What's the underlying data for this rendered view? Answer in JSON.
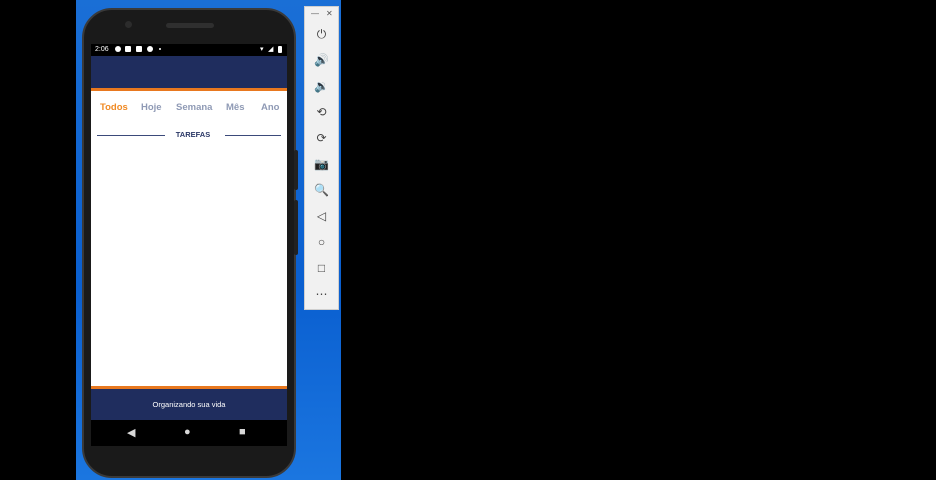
{
  "status_bar": {
    "time": "2:06"
  },
  "tabs": [
    {
      "label": "Todos",
      "active": true
    },
    {
      "label": "Hoje"
    },
    {
      "label": "Semana"
    },
    {
      "label": "Mês"
    },
    {
      "label": "Ano"
    }
  ],
  "section": {
    "title": "TAREFAS"
  },
  "footer": {
    "text": "Organizando sua vida"
  },
  "colors": {
    "brand": "#1f2d5e",
    "accent": "#e8781f",
    "active_tab": "#f08a24",
    "inactive_tab": "#8f9ab5"
  },
  "emulator_toolbar": {
    "window_controls": [
      "minimize-icon",
      "close-icon"
    ],
    "items": [
      "power-icon",
      "volume-up-icon",
      "volume-down-icon",
      "rotate-left-icon",
      "rotate-right-icon",
      "camera-icon",
      "zoom-icon",
      "back-icon",
      "home-icon",
      "overview-icon",
      "more-icon"
    ]
  }
}
